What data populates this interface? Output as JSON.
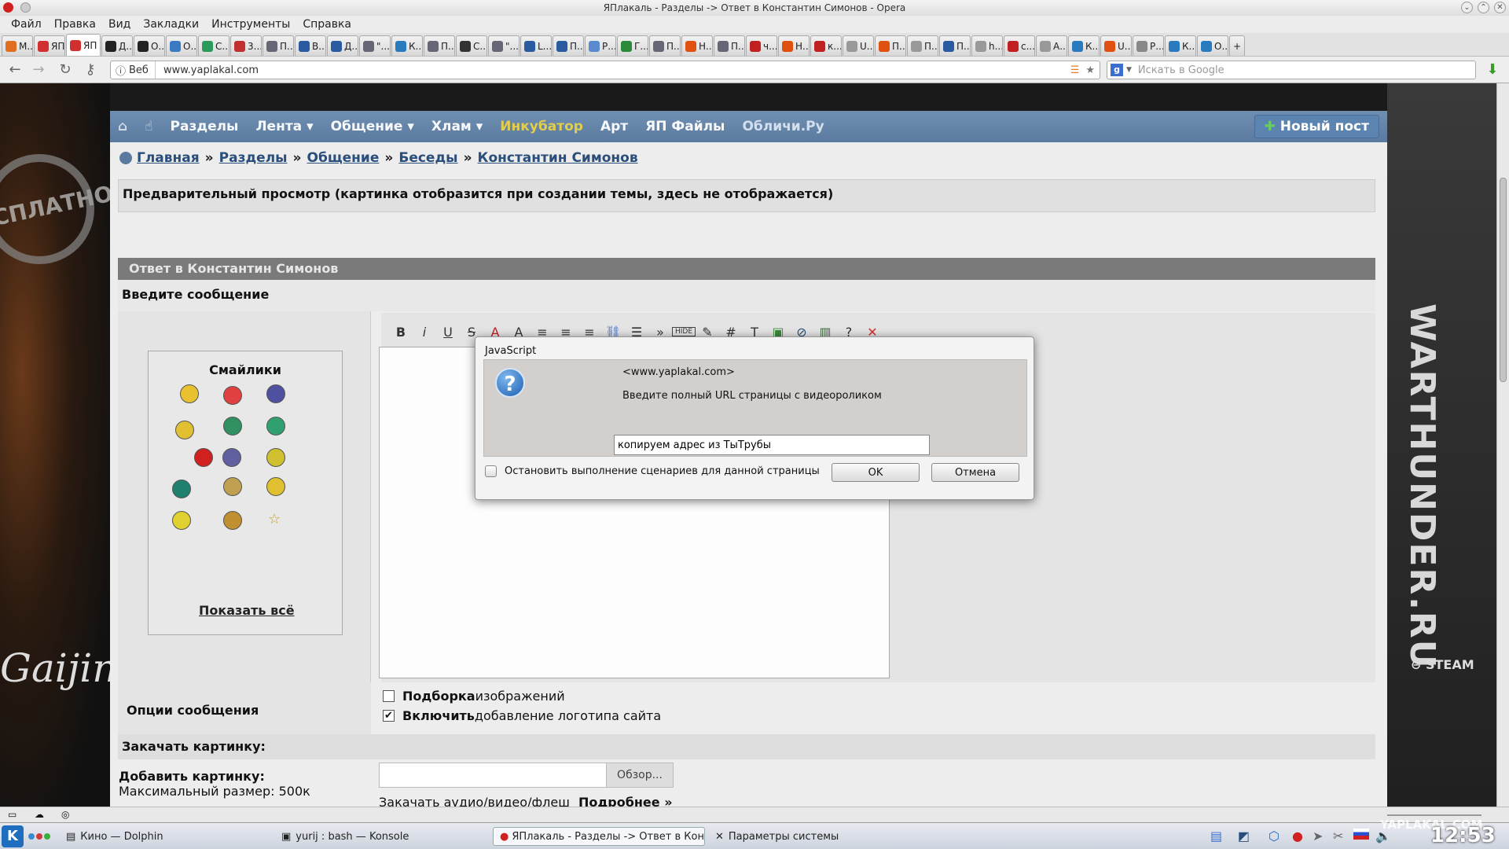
{
  "window": {
    "title": "ЯПлакаль - Разделы -> Ответ в Константин Симонов - Opera"
  },
  "menu": [
    "Файл",
    "Правка",
    "Вид",
    "Закладки",
    "Инструменты",
    "Справка"
  ],
  "tabs": [
    {
      "label": "М...",
      "color": "#e07020"
    },
    {
      "label": "ЯП У...",
      "color": "#d03030"
    },
    {
      "label": "ЯП",
      "color": "#d03030",
      "active": true
    },
    {
      "label": "Д...",
      "color": "#222"
    },
    {
      "label": "О...",
      "color": "#222"
    },
    {
      "label": "О...",
      "color": "#3a7ac0"
    },
    {
      "label": "С...",
      "color": "#2a9a5a"
    },
    {
      "label": "3...",
      "color": "#c03030"
    },
    {
      "label": "П...",
      "color": "#667"
    },
    {
      "label": "В...",
      "color": "#2a5aa0"
    },
    {
      "label": "Д...",
      "color": "#2a5aa0"
    },
    {
      "label": "\"...",
      "color": "#667"
    },
    {
      "label": "К...",
      "color": "#2a7ac0"
    },
    {
      "label": "П...",
      "color": "#667"
    },
    {
      "label": "С...",
      "color": "#333"
    },
    {
      "label": "\"...",
      "color": "#667"
    },
    {
      "label": "L...",
      "color": "#2a5aa0"
    },
    {
      "label": "П...",
      "color": "#2a5aa0"
    },
    {
      "label": "Р...",
      "color": "#5a8ad0"
    },
    {
      "label": "Г...",
      "color": "#2a8a3a"
    },
    {
      "label": "П...",
      "color": "#667"
    },
    {
      "label": "Н...",
      "color": "#e05010"
    },
    {
      "label": "П...",
      "color": "#667"
    },
    {
      "label": "ч...",
      "color": "#c02020"
    },
    {
      "label": "Н...",
      "color": "#e05010"
    },
    {
      "label": "к...",
      "color": "#c02020"
    },
    {
      "label": "U...",
      "color": "#999"
    },
    {
      "label": "П...",
      "color": "#e05010"
    },
    {
      "label": "П...",
      "color": "#999"
    },
    {
      "label": "П...",
      "color": "#2a5aa0"
    },
    {
      "label": "h...",
      "color": "#999"
    },
    {
      "label": "с...",
      "color": "#c02020"
    },
    {
      "label": "А...",
      "color": "#999"
    },
    {
      "label": "К...",
      "color": "#2a7ac0"
    },
    {
      "label": "U...",
      "color": "#e05010"
    },
    {
      "label": "Р...",
      "color": "#888"
    },
    {
      "label": "К...",
      "color": "#2a7ac0"
    },
    {
      "label": "О...",
      "color": "#2a7ac0"
    }
  ],
  "address": {
    "badge": "Веб",
    "url": "www.yaplakal.com",
    "search_placeholder": "Искать в Google"
  },
  "site": {
    "nav": [
      "Разделы",
      "Лента ▾",
      "Общение ▾",
      "Хлам ▾",
      "Инкубатор",
      "Арт",
      "ЯП Файлы",
      "Обличи.Ру"
    ],
    "new_post": "Новый пост",
    "breadcrumb": [
      "Главная",
      "Разделы",
      "Общение",
      "Беседы",
      "Константин Симонов"
    ],
    "preview_text": "Предварительный просмотр (картинка отобразится при создании темы, здесь не отображается)",
    "reply_header": "Ответ в Константин Симонов",
    "enter_message": "Введите сообщение",
    "smileys_title": "Смайлики",
    "show_all": "Показать всё",
    "options_label": "Опции сообщения",
    "options": [
      {
        "bold": "Подборка",
        "rest": " изображений",
        "checked": false
      },
      {
        "bold": "Включить",
        "rest": " добавление логотипа сайта",
        "checked": true
      }
    ],
    "upload_header": "Закачать картинку:",
    "add_picture": "Добавить картинку:",
    "max_size": "Максимальный размер: 500к",
    "browse": "Обзор...",
    "media_text": "Закачать аудио/видео/флеш",
    "media_more": "Подробнее »",
    "bg_left": "СПЛАТНО",
    "bg_right": "WARTHUNDER.RU",
    "bg_gaijin": "Gaijin",
    "bg_steam": "STEAM"
  },
  "dialog": {
    "title": "JavaScript",
    "site": "<www.yaplakal.com>",
    "message": "Введите полный URL страницы с видеороликом",
    "input_value": "копируем адрес из ТыТрубы",
    "stop_scripts": "Остановить выполнение сценариев для данной страницы",
    "ok": "OK",
    "cancel": "Отмена"
  },
  "taskbar": {
    "items": [
      "Кино — Dolphin",
      "yurij : bash — Konsole",
      "ЯПлакаль - Разделы -> Ответ в Констант",
      "Параметры системы"
    ],
    "clock": "12:53",
    "watermark": "YAPLAKAL.COM"
  }
}
